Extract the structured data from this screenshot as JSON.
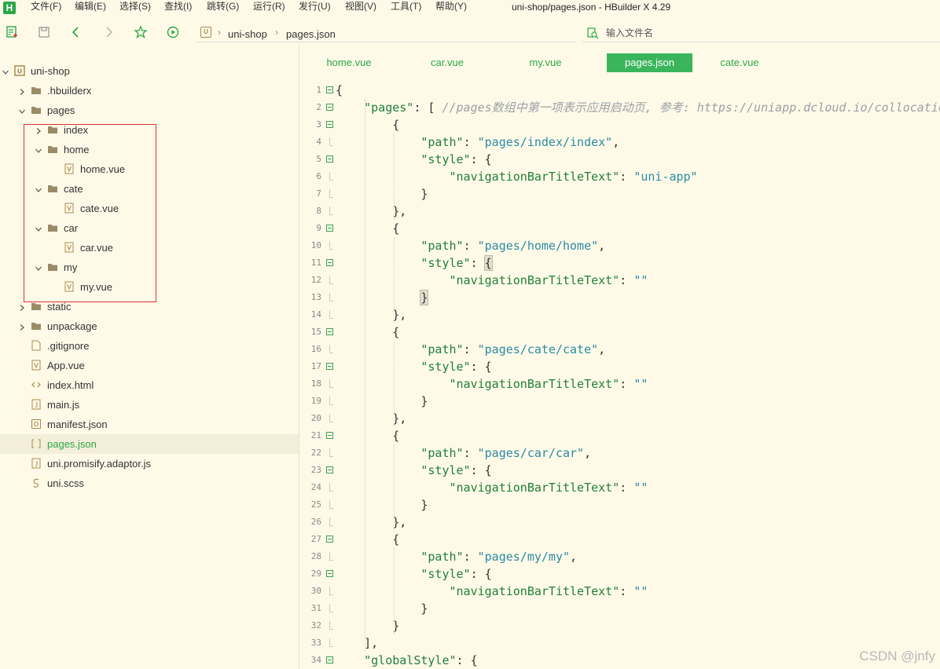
{
  "app": {
    "logo_text": "H",
    "title": "uni-shop/pages.json - HBuilder X 4.29",
    "accent_color": "#2aa845"
  },
  "menu": [
    "文件(F)",
    "编辑(E)",
    "选择(S)",
    "查找(I)",
    "跳转(G)",
    "运行(R)",
    "发行(U)",
    "视图(V)",
    "工具(T)",
    "帮助(Y)"
  ],
  "toolbar": {
    "buttons": [
      "new-file-icon",
      "save-icon",
      "back-icon",
      "forward-icon",
      "favorite-star-icon",
      "run-icon"
    ],
    "breadcrumb": [
      "uni-shop",
      "pages.json"
    ],
    "file_search_placeholder": "输入文件名"
  },
  "sidebar": {
    "tree": [
      {
        "label": "uni-shop",
        "icon": "project-icon",
        "expanded": true
      },
      {
        "label": ".hbuilderx",
        "icon": "folder-icon",
        "expanded": false
      },
      {
        "label": "pages",
        "icon": "folder-icon",
        "expanded": true
      },
      {
        "label": "index",
        "icon": "folder-icon",
        "expanded": false
      },
      {
        "label": "home",
        "icon": "folder-icon",
        "expanded": true
      },
      {
        "label": "home.vue",
        "icon": "vue-file-icon"
      },
      {
        "label": "cate",
        "icon": "folder-icon",
        "expanded": true
      },
      {
        "label": "cate.vue",
        "icon": "vue-file-icon"
      },
      {
        "label": "car",
        "icon": "folder-icon",
        "expanded": true
      },
      {
        "label": "car.vue",
        "icon": "vue-file-icon"
      },
      {
        "label": "my",
        "icon": "folder-icon",
        "expanded": true
      },
      {
        "label": "my.vue",
        "icon": "vue-file-icon"
      },
      {
        "label": "static",
        "icon": "folder-icon",
        "expanded": false
      },
      {
        "label": "unpackage",
        "icon": "folder-icon",
        "expanded": false
      },
      {
        "label": ".gitignore",
        "icon": "file-icon"
      },
      {
        "label": "App.vue",
        "icon": "vue-file-icon"
      },
      {
        "label": "index.html",
        "icon": "html-file-icon"
      },
      {
        "label": "main.js",
        "icon": "js-file-icon"
      },
      {
        "label": "manifest.json",
        "icon": "manifest-file-icon"
      },
      {
        "label": "pages.json",
        "icon": "json-file-icon",
        "selected": true
      },
      {
        "label": "uni.promisify.adaptor.js",
        "icon": "js-file-icon"
      },
      {
        "label": "uni.scss",
        "icon": "scss-file-icon"
      }
    ]
  },
  "tabs": [
    {
      "label": "home.vue",
      "active": false
    },
    {
      "label": "car.vue",
      "active": false
    },
    {
      "label": "my.vue",
      "active": false
    },
    {
      "label": "pages.json",
      "active": true
    },
    {
      "label": "cate.vue",
      "active": false
    }
  ],
  "editor": {
    "lines": [
      {
        "n": "1",
        "fold": true,
        "code": "{"
      },
      {
        "n": "2",
        "fold": true,
        "code": "    \"pages\": [ //pages数组中第一项表示应用启动页, 参考: https://uniapp.dcloud.io/collocation/pages"
      },
      {
        "n": "3",
        "fold": true,
        "code": "        {"
      },
      {
        "n": "4",
        "fold": false,
        "code": "            \"path\": \"pages/index/index\","
      },
      {
        "n": "5",
        "fold": true,
        "code": "            \"style\": {"
      },
      {
        "n": "6",
        "fold": false,
        "code": "                \"navigationBarTitleText\": \"uni-app\""
      },
      {
        "n": "7",
        "fold": false,
        "code": "            }"
      },
      {
        "n": "8",
        "fold": false,
        "code": "        },"
      },
      {
        "n": "9",
        "fold": true,
        "code": "        {"
      },
      {
        "n": "10",
        "fold": false,
        "code": "            \"path\": \"pages/home/home\","
      },
      {
        "n": "11",
        "fold": true,
        "code": "            \"style\": {"
      },
      {
        "n": "12",
        "fold": false,
        "code": "                \"navigationBarTitleText\": \"\""
      },
      {
        "n": "13",
        "fold": false,
        "code": "            }"
      },
      {
        "n": "14",
        "fold": false,
        "code": "        },"
      },
      {
        "n": "15",
        "fold": true,
        "code": "        {"
      },
      {
        "n": "16",
        "fold": false,
        "code": "            \"path\": \"pages/cate/cate\","
      },
      {
        "n": "17",
        "fold": true,
        "code": "            \"style\": {"
      },
      {
        "n": "18",
        "fold": false,
        "code": "                \"navigationBarTitleText\": \"\""
      },
      {
        "n": "19",
        "fold": false,
        "code": "            }"
      },
      {
        "n": "20",
        "fold": false,
        "code": "        },"
      },
      {
        "n": "21",
        "fold": true,
        "code": "        {"
      },
      {
        "n": "22",
        "fold": false,
        "code": "            \"path\": \"pages/car/car\","
      },
      {
        "n": "23",
        "fold": true,
        "code": "            \"style\": {"
      },
      {
        "n": "24",
        "fold": false,
        "code": "                \"navigationBarTitleText\": \"\""
      },
      {
        "n": "25",
        "fold": false,
        "code": "            }"
      },
      {
        "n": "26",
        "fold": false,
        "code": "        },"
      },
      {
        "n": "27",
        "fold": true,
        "code": "        {"
      },
      {
        "n": "28",
        "fold": false,
        "code": "            \"path\": \"pages/my/my\","
      },
      {
        "n": "29",
        "fold": true,
        "code": "            \"style\": {"
      },
      {
        "n": "30",
        "fold": false,
        "code": "                \"navigationBarTitleText\": \"\""
      },
      {
        "n": "31",
        "fold": false,
        "code": "            }"
      },
      {
        "n": "32",
        "fold": false,
        "code": "        }"
      },
      {
        "n": "33",
        "fold": false,
        "code": "    ],"
      },
      {
        "n": "34",
        "fold": true,
        "code": "    \"globalStyle\": {"
      }
    ]
  },
  "watermark": "CSDN @jnfy"
}
